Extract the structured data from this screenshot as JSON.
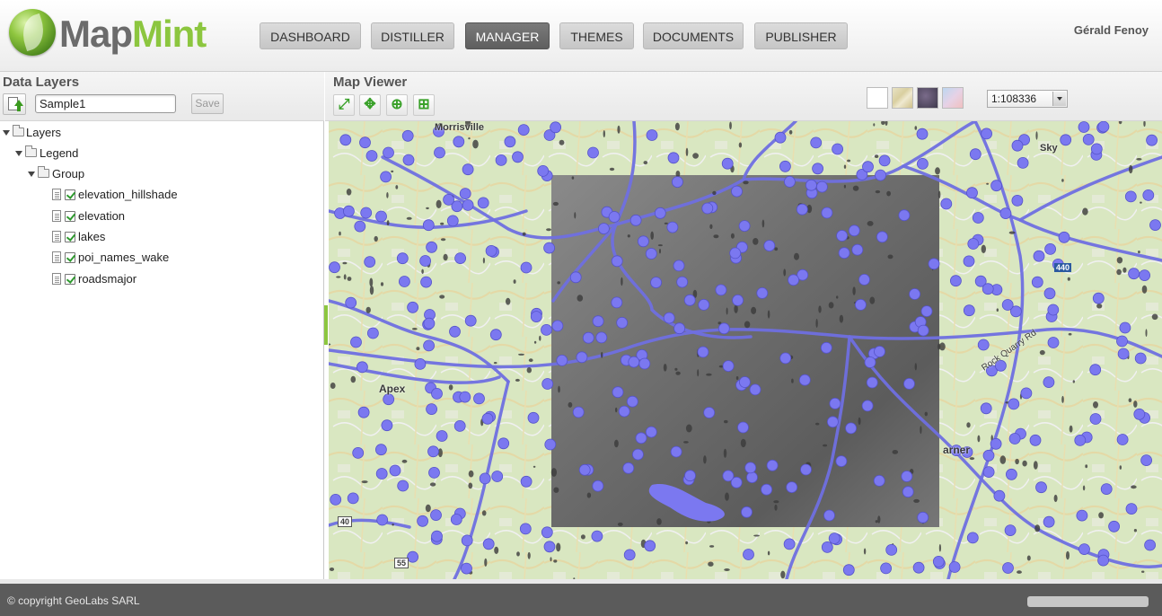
{
  "app": {
    "brand_part1": "Map",
    "brand_part2": "Mint",
    "user": "Gérald Fenoy"
  },
  "nav": {
    "items": [
      {
        "label": "DASHBOARD",
        "active": false
      },
      {
        "label": "DISTILLER",
        "active": false
      },
      {
        "label": "MANAGER",
        "active": true
      },
      {
        "label": "THEMES",
        "active": false
      },
      {
        "label": "DOCUMENTS",
        "active": false
      },
      {
        "label": "PUBLISHER",
        "active": false
      }
    ]
  },
  "data_layers": {
    "title": "Data Layers",
    "map_name_value": "Sample1",
    "save_label": "Save",
    "tree": {
      "root": "Layers",
      "legend": "Legend",
      "group": "Group",
      "layers": [
        {
          "name": "elevation_hillshade",
          "checked": true
        },
        {
          "name": "elevation",
          "checked": true
        },
        {
          "name": "lakes",
          "checked": true
        },
        {
          "name": "poi_names_wake",
          "checked": true
        },
        {
          "name": "roadsmajor",
          "checked": true
        }
      ]
    }
  },
  "map_viewer": {
    "title": "Map Viewer",
    "tools": [
      "zoom-extent-icon",
      "pan-icon",
      "zoom-in-icon",
      "zoom-box-icon"
    ],
    "scale": "1:108336",
    "map_labels": {
      "morrisville": "Morrisville",
      "apex": "Apex",
      "garner": "arner",
      "skyline": "Sky",
      "rock_quarry": "Rock Quarry Rd",
      "i440": "440",
      "i40": "40",
      "hwy55": "55"
    },
    "colors": {
      "poi": "#7b78f0",
      "roads": "#6f6fe0",
      "terrain_light": "#d7e6bd",
      "hillshade": "#808080"
    }
  },
  "footer": {
    "copyright": "© copyright GeoLabs SARL"
  }
}
